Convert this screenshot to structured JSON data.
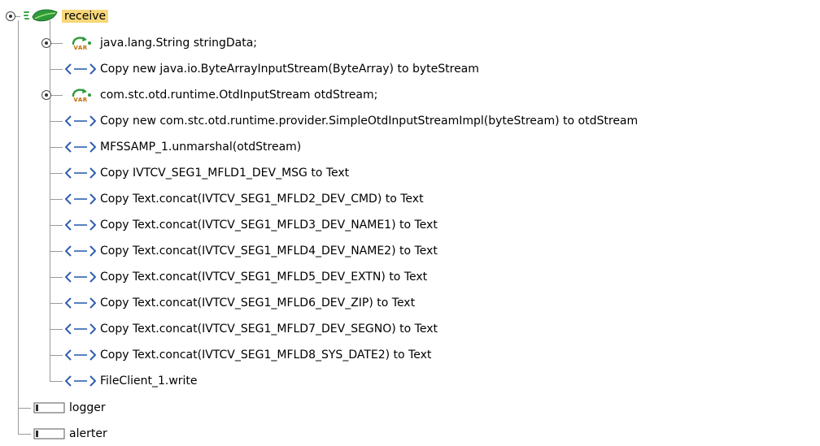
{
  "tree": {
    "root": {
      "label": "receive"
    },
    "children": [
      {
        "type": "var",
        "label": "java.lang.String stringData;",
        "var_icon_text": "VAR"
      },
      {
        "type": "op",
        "label": "Copy new java.io.ByteArrayInputStream(ByteArray) to byteStream"
      },
      {
        "type": "var",
        "label": "com.stc.otd.runtime.OtdInputStream otdStream;",
        "var_icon_text": "VAR"
      },
      {
        "type": "op",
        "label": "Copy new com.stc.otd.runtime.provider.SimpleOtdInputStreamImpl(byteStream) to otdStream"
      },
      {
        "type": "op",
        "label": "MFSSAMP_1.unmarshal(otdStream)"
      },
      {
        "type": "op",
        "label": "Copy IVTCV_SEG1_MFLD1_DEV_MSG to Text"
      },
      {
        "type": "op",
        "label": "Copy Text.concat(IVTCV_SEG1_MFLD2_DEV_CMD) to Text"
      },
      {
        "type": "op",
        "label": "Copy Text.concat(IVTCV_SEG1_MFLD3_DEV_NAME1) to Text"
      },
      {
        "type": "op",
        "label": "Copy Text.concat(IVTCV_SEG1_MFLD4_DEV_NAME2) to Text"
      },
      {
        "type": "op",
        "label": "Copy Text.concat(IVTCV_SEG1_MFLD5_DEV_EXTN) to Text"
      },
      {
        "type": "op",
        "label": "Copy Text.concat(IVTCV_SEG1_MFLD6_DEV_ZIP) to Text"
      },
      {
        "type": "op",
        "label": "Copy Text.concat(IVTCV_SEG1_MFLD7_DEV_SEGNO) to Text"
      },
      {
        "type": "op",
        "label": "Copy Text.concat(IVTCV_SEG1_MFLD8_SYS_DATE2) to Text"
      },
      {
        "type": "op",
        "label": "FileClient_1.write"
      }
    ],
    "siblings": [
      {
        "label": "logger"
      },
      {
        "label": "alerter"
      }
    ]
  },
  "colors": {
    "selection": "#f7d77a",
    "tree_line": "#9a9a9a",
    "op_icon": "#2f5fb3",
    "leaf_icon": "#1c8f2a",
    "var_icon": "#c06a00"
  }
}
